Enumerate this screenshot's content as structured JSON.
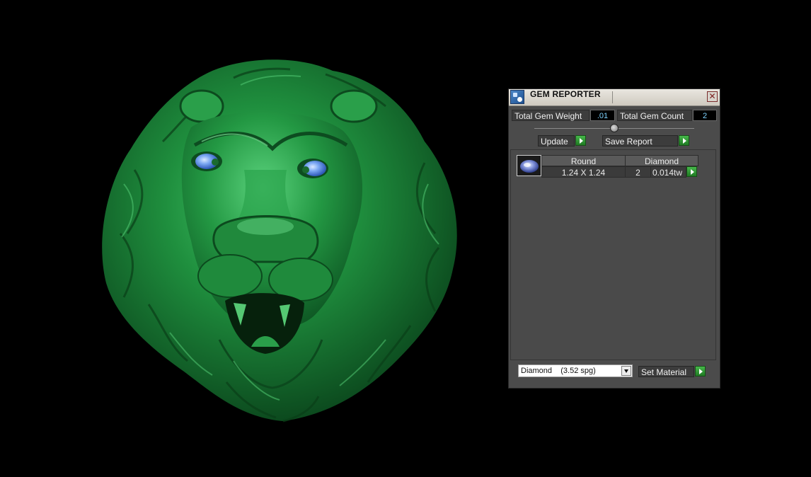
{
  "panel": {
    "title": "GEM REPORTER",
    "close_glyph": "✕",
    "total_gem_weight_label": "Total Gem Weight",
    "total_gem_weight_value": ".01",
    "total_gem_count_label": "Total Gem Count",
    "total_gem_count_value": "2",
    "update_label": "Update",
    "save_report_label": "Save Report",
    "set_material_label": "Set Material",
    "material_selected": "Diamond    (3.52 spg)"
  },
  "gem_rows": [
    {
      "shape": "Round",
      "material": "Diamond",
      "size": "1.24 X 1.24",
      "count": "2",
      "weight": "0.014tw"
    }
  ],
  "icons": {
    "app": "gem-reporter-icon",
    "close": "close-icon",
    "play": "play-arrow-icon",
    "dropdown": "chevron-down-icon",
    "gem": "round-gem-icon"
  },
  "colors": {
    "model_green": "#1f8a3c",
    "eye_blue": "#6f9ff0",
    "value_text": "#7ed4ff",
    "button_green": "#2f9a34"
  }
}
